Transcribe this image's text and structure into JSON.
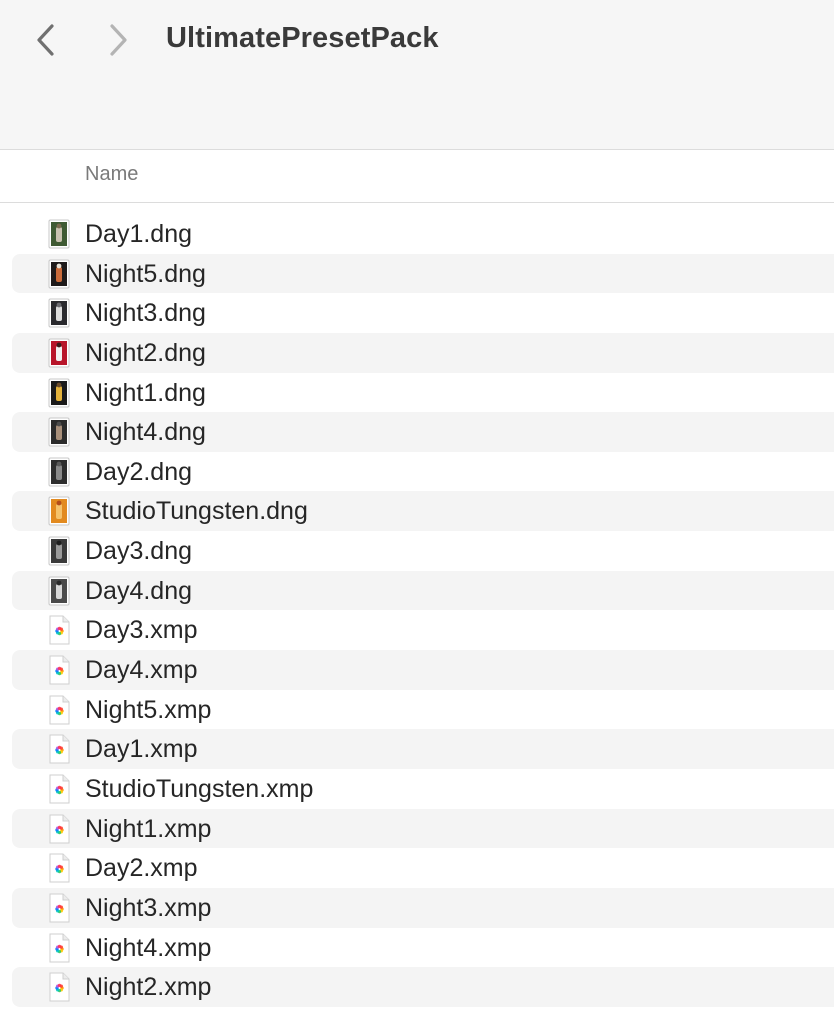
{
  "window": {
    "title": "UltimatePresetPack"
  },
  "toolbar": {
    "back_icon": "chevron-left-icon",
    "forward_icon": "chevron-right-icon"
  },
  "list_header": {
    "name_column": "Name"
  },
  "files": [
    {
      "name": "Day1.dng",
      "kind": "dng",
      "thumb": [
        "#3f5a33",
        "#c9c2b0",
        "#7a6a4e"
      ]
    },
    {
      "name": "Night5.dng",
      "kind": "dng",
      "thumb": [
        "#1e1a1a",
        "#c96a3a",
        "#e9e2d6"
      ]
    },
    {
      "name": "Night3.dng",
      "kind": "dng",
      "thumb": [
        "#2a2a2e",
        "#dcdcdc",
        "#6b6b70"
      ]
    },
    {
      "name": "Night2.dng",
      "kind": "dng",
      "thumb": [
        "#b8152a",
        "#f1f1f1",
        "#3a1a1a"
      ]
    },
    {
      "name": "Night1.dng",
      "kind": "dng",
      "thumb": [
        "#1a1a1a",
        "#e3b13a",
        "#6a4a2a"
      ]
    },
    {
      "name": "Night4.dng",
      "kind": "dng",
      "thumb": [
        "#2b2b2b",
        "#a88f7a",
        "#4c4c4c"
      ]
    },
    {
      "name": "Day2.dng",
      "kind": "dng",
      "thumb": [
        "#2e2e2e",
        "#8a8a8a",
        "#5a5a5a"
      ]
    },
    {
      "name": "StudioTungsten.dng",
      "kind": "dng",
      "thumb": [
        "#e28a1f",
        "#f5c26b",
        "#b34d1c"
      ]
    },
    {
      "name": "Day3.dng",
      "kind": "dng",
      "thumb": [
        "#3a3a3a",
        "#9a9a9a",
        "#1f1f1f"
      ]
    },
    {
      "name": "Day4.dng",
      "kind": "dng",
      "thumb": [
        "#4a4a4a",
        "#d8d8d8",
        "#2a2a2a"
      ]
    },
    {
      "name": "Day3.xmp",
      "kind": "xmp"
    },
    {
      "name": "Day4.xmp",
      "kind": "xmp"
    },
    {
      "name": "Night5.xmp",
      "kind": "xmp"
    },
    {
      "name": "Day1.xmp",
      "kind": "xmp"
    },
    {
      "name": "StudioTungsten.xmp",
      "kind": "xmp"
    },
    {
      "name": "Night1.xmp",
      "kind": "xmp"
    },
    {
      "name": "Day2.xmp",
      "kind": "xmp"
    },
    {
      "name": "Night3.xmp",
      "kind": "xmp"
    },
    {
      "name": "Night4.xmp",
      "kind": "xmp"
    },
    {
      "name": "Night2.xmp",
      "kind": "xmp"
    }
  ],
  "icons": {
    "dng": "image-file-icon",
    "xmp": "photos-document-icon"
  }
}
